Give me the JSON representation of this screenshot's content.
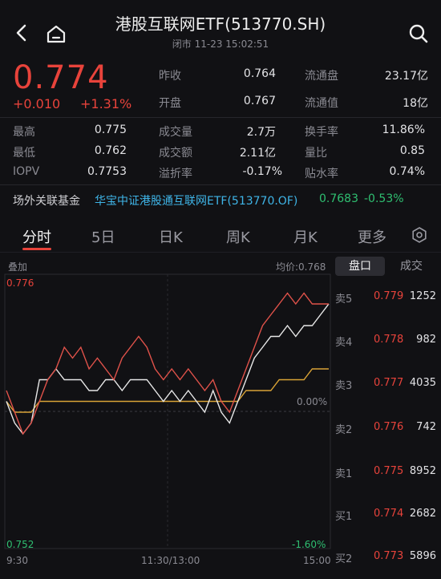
{
  "header": {
    "title": "港股互联网ETF(513770.SH)",
    "subtitle": "闭市 11-23 15:02:51"
  },
  "quote": {
    "price": "0.774",
    "change": "+0.010",
    "change_pct": "+1.31%"
  },
  "stats": [
    {
      "label": "昨收",
      "value": "0.764",
      "label2": "流通盘",
      "value2": "23.17亿"
    },
    {
      "label": "开盘",
      "value": "0.767",
      "label2": "流通值",
      "value2": "18亿"
    }
  ],
  "stats2": [
    {
      "l1": "最高",
      "v1": "0.775",
      "l2": "成交量",
      "v2": "2.7万",
      "l3": "换手率",
      "v3": "11.86%"
    },
    {
      "l1": "最低",
      "v1": "0.762",
      "l2": "成交额",
      "v2": "2.11亿",
      "l3": "量比",
      "v3": "0.85"
    },
    {
      "l1": "IOPV",
      "v1": "0.7753",
      "l2": "溢折率",
      "v2": "-0.17%",
      "l3": "贴水率",
      "v3": "0.74%"
    }
  ],
  "fund": {
    "label": "场外关联基金",
    "name": "华宝中证港股通互联网ETF(513770.OF)",
    "price": "0.7683",
    "change": "-0.53%"
  },
  "tabs": [
    "分时",
    "5日",
    "日K",
    "周K",
    "月K",
    "更多"
  ],
  "chart_labels": {
    "overlay": "叠加",
    "avg_price": "均价:0.768",
    "y_top": "0.776",
    "y_bottom": "0.752",
    "pct_mid": "0.00%",
    "pct_bottom": "-1.60%",
    "x_left": "9:30",
    "x_mid": "11:30/13:00",
    "x_right": "15:00"
  },
  "orderbook": {
    "tabs": [
      "盘口",
      "成交"
    ],
    "rows": [
      {
        "side": "卖5",
        "price": "0.779",
        "vol": "1252"
      },
      {
        "side": "卖4",
        "price": "0.778",
        "vol": "982"
      },
      {
        "side": "卖3",
        "price": "0.777",
        "vol": "4035"
      },
      {
        "side": "卖2",
        "price": "0.776",
        "vol": "742"
      },
      {
        "side": "卖1",
        "price": "0.775",
        "vol": "8952"
      },
      {
        "side": "买1",
        "price": "0.774",
        "vol": "2682"
      },
      {
        "side": "买2",
        "price": "0.773",
        "vol": "5896"
      }
    ]
  },
  "chart_data": {
    "type": "line",
    "ylim": [
      0.752,
      0.776
    ],
    "baseline": 0.764,
    "series": [
      {
        "values": [
          0.766,
          0.764,
          0.762,
          0.763,
          0.765,
          0.767,
          0.768,
          0.77,
          0.769,
          0.77,
          0.768,
          0.769,
          0.768,
          0.767,
          0.769,
          0.77,
          0.771,
          0.77,
          0.768,
          0.767,
          0.768,
          0.767,
          0.768,
          0.767,
          0.766,
          0.767,
          0.765,
          0.764,
          0.766,
          0.768,
          0.77,
          0.772,
          0.773,
          0.774,
          0.775,
          0.774,
          0.775,
          0.774,
          0.774,
          0.774
        ]
      },
      {
        "values": [
          0.765,
          0.763,
          0.762,
          0.763,
          0.767,
          0.767,
          0.768,
          0.767,
          0.767,
          0.767,
          0.766,
          0.766,
          0.767,
          0.767,
          0.766,
          0.767,
          0.767,
          0.767,
          0.766,
          0.765,
          0.766,
          0.765,
          0.766,
          0.765,
          0.764,
          0.766,
          0.764,
          0.763,
          0.765,
          0.767,
          0.769,
          0.77,
          0.771,
          0.771,
          0.772,
          0.771,
          0.772,
          0.772,
          0.773,
          0.774
        ]
      },
      {
        "values": [
          0.765,
          0.764,
          0.764,
          0.764,
          0.765,
          0.765,
          0.765,
          0.765,
          0.765,
          0.765,
          0.765,
          0.765,
          0.765,
          0.765,
          0.765,
          0.765,
          0.765,
          0.765,
          0.765,
          0.765,
          0.765,
          0.765,
          0.765,
          0.765,
          0.765,
          0.765,
          0.765,
          0.765,
          0.765,
          0.766,
          0.766,
          0.766,
          0.766,
          0.767,
          0.767,
          0.767,
          0.767,
          0.768,
          0.768,
          0.768
        ]
      }
    ]
  }
}
